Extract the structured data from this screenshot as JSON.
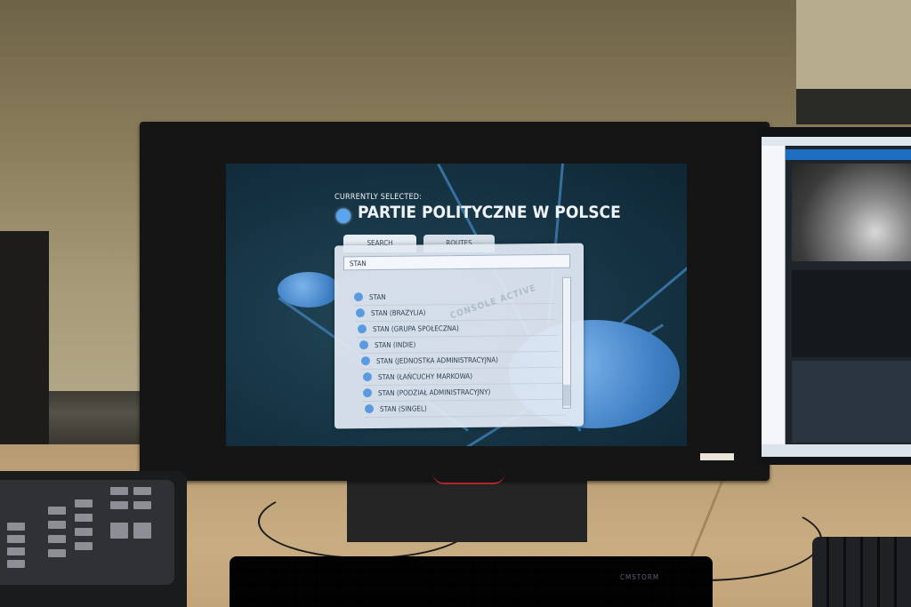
{
  "scene": {
    "description_colors": {
      "screen_bg": "#163444",
      "accent": "#5aa4ee",
      "panel": "#e2eaf3"
    }
  },
  "app": {
    "currently_selected_label": "CURRENTLY SELECTED:",
    "selected_title": "PARTIE POLITYCZNE W POLSCE",
    "tabs": [
      "SEARCH",
      "ROUTES"
    ],
    "search_value": "STAN",
    "results": [
      "STAN",
      "STAN (BRAZYLIA)",
      "STAN (GRUPA SPOŁECZNA)",
      "STAN (INDIE)",
      "STAN (JEDNOSTKA ADMINISTRACYJNA)",
      "STAN (ŁAŃCUCHY MARKOWA)",
      "STAN (PODZIAŁ ADMINISTRACYJNY)",
      "STAN (SINGEL)"
    ],
    "watermark": "CONSOLE ACTIVE"
  },
  "keyboard": {
    "brand": "CMSTORM"
  }
}
